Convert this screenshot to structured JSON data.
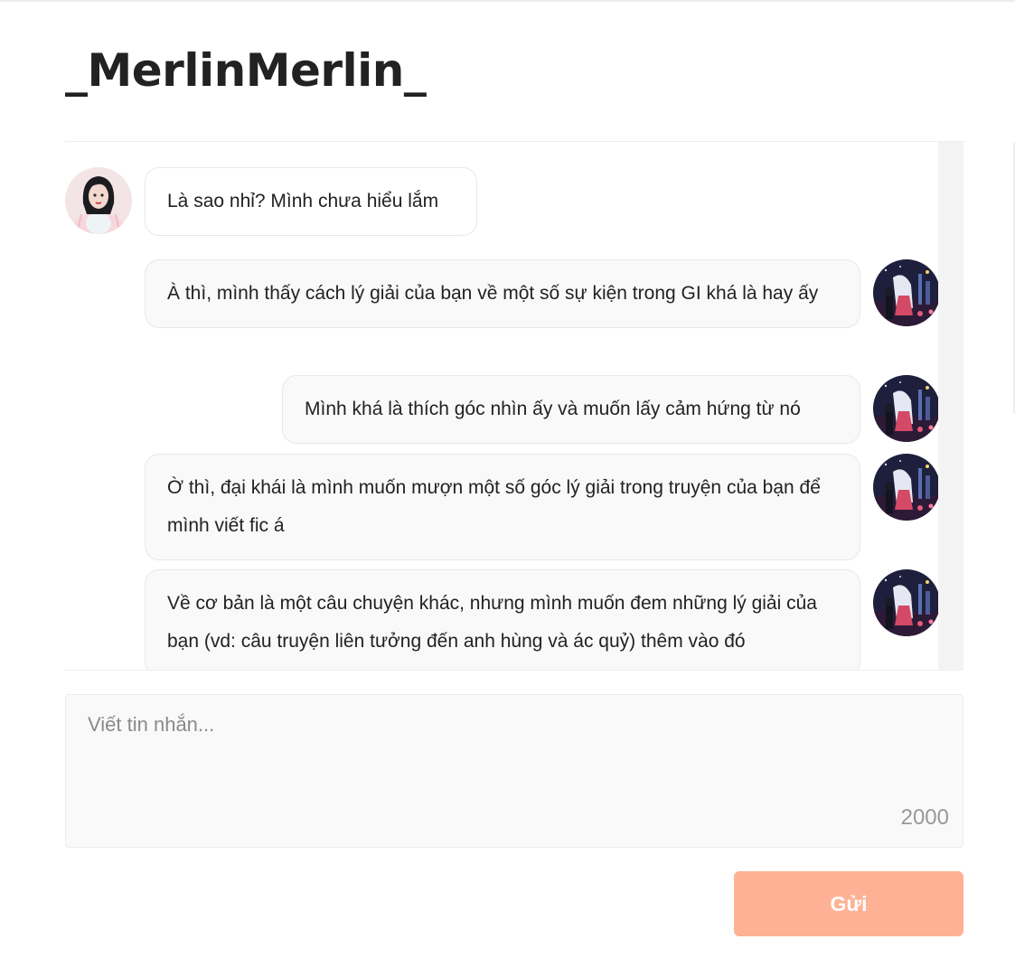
{
  "header": {
    "title": "_MerlinMerlin_"
  },
  "chat": {
    "messages": [
      {
        "direction": "incoming",
        "avatar": "girl-portrait-avatar",
        "text": "Là sao nhỉ? Mình chưa hiểu lắm"
      },
      {
        "direction": "outgoing",
        "avatar": "night-city-avatar",
        "text": "À thì, mình thấy cách lý giải của bạn về một số sự kiện trong GI khá là hay ấy"
      },
      {
        "direction": "outgoing",
        "avatar": "night-city-avatar",
        "text": "Mình khá là thích góc nhìn ấy và muốn lấy cảm hứng từ nó"
      },
      {
        "direction": "outgoing",
        "avatar": "night-city-avatar",
        "text": "Ờ thì, đại khái là mình muốn mượn một số góc lý giải trong truyện của bạn để mình viết fic á"
      },
      {
        "direction": "outgoing",
        "avatar": "night-city-avatar",
        "text": "Về cơ bản là một câu chuyện khác, nhưng mình muốn đem những lý giải của bạn (vd: câu truyện liên tưởng đến anh hùng và ác quỷ) thêm vào đó"
      }
    ]
  },
  "composer": {
    "placeholder": "Viết tin nhắn...",
    "value": "",
    "char_count": "2000"
  },
  "send_button": {
    "label": "Gửi",
    "color": "#ffb195"
  }
}
